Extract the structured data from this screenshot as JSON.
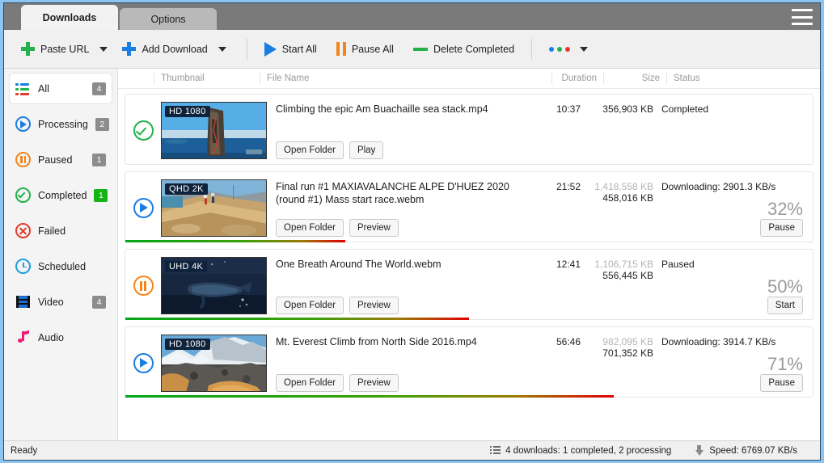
{
  "titlebar": {
    "tabs": [
      {
        "label": "Downloads",
        "active": true
      },
      {
        "label": "Options",
        "active": false
      }
    ],
    "menu_icon": "hamburger-icon"
  },
  "toolbar": {
    "paste_url": "Paste URL",
    "add_download": "Add Download",
    "start_all": "Start All",
    "pause_all": "Pause All",
    "delete_completed": "Delete Completed",
    "more_dots": [
      "#1a7ee0",
      "#22b14c",
      "#e23b2e"
    ]
  },
  "sidebar": {
    "items": [
      {
        "label": "All",
        "icon": "list-icon",
        "badge": "4",
        "badge_color": "#8c8c8c",
        "active": true
      },
      {
        "label": "Processing",
        "icon": "play-icon",
        "badge": "2",
        "badge_color": "#8c8c8c",
        "active": false
      },
      {
        "label": "Paused",
        "icon": "pause-icon",
        "badge": "1",
        "badge_color": "#8c8c8c",
        "active": false
      },
      {
        "label": "Completed",
        "icon": "check-icon",
        "badge": "1",
        "badge_color": "#16b317",
        "active": false
      },
      {
        "label": "Failed",
        "icon": "error-icon",
        "badge": "",
        "badge_color": "",
        "active": false
      },
      {
        "label": "Scheduled",
        "icon": "clock-icon",
        "badge": "",
        "badge_color": "",
        "active": false
      },
      {
        "label": "Video",
        "icon": "film-icon",
        "badge": "4",
        "badge_color": "#8c8c8c",
        "active": false
      },
      {
        "label": "Audio",
        "icon": "music-note-icon",
        "badge": "",
        "badge_color": "",
        "active": false
      }
    ]
  },
  "list": {
    "columns": {
      "thumbnail": "Thumbnail",
      "file_name": "File Name",
      "duration": "Duration",
      "size": "Size",
      "status": "Status"
    },
    "rows": [
      {
        "state": "completed",
        "quality": "HD 1080",
        "file_name": "Climbing the epic Am Buachaille sea stack.mp4",
        "duration": "10:37",
        "size_total": "356,903 KB",
        "size_done": "",
        "status_text": "Completed",
        "percent": "",
        "progress": 0,
        "buttons": [
          "Open Folder",
          "Play"
        ],
        "action_button": ""
      },
      {
        "state": "downloading",
        "quality": "QHD 2K",
        "file_name": "Final run #1  MAXIAVALANCHE ALPE D'HUEZ 2020 (round #1) Mass start race.webm",
        "duration": "21:52",
        "size_total": "1,418,558 KB",
        "size_done": "458,016 KB",
        "status_text": "Downloading: 2901.3 KB/s",
        "percent": "32%",
        "progress": 32,
        "buttons": [
          "Open Folder",
          "Preview"
        ],
        "action_button": "Pause"
      },
      {
        "state": "paused",
        "quality": "UHD 4K",
        "file_name": "One Breath Around The World.webm",
        "duration": "12:41",
        "size_total": "1,106,715 KB",
        "size_done": "556,445 KB",
        "status_text": "Paused",
        "percent": "50%",
        "progress": 50,
        "buttons": [
          "Open Folder",
          "Preview"
        ],
        "action_button": "Start"
      },
      {
        "state": "downloading",
        "quality": "HD 1080",
        "file_name": "Mt. Everest Climb from North Side 2016.mp4",
        "duration": "56:46",
        "size_total": "982,095 KB",
        "size_done": "701,352 KB",
        "status_text": "Downloading: 3914.7 KB/s",
        "percent": "71%",
        "progress": 71,
        "buttons": [
          "Open Folder",
          "Preview"
        ],
        "action_button": "Pause"
      }
    ]
  },
  "statusbar": {
    "ready": "Ready",
    "downloads_summary": "4 downloads: 1 completed, 2 processing",
    "speed": "Speed: 6769.07 KB/s"
  }
}
